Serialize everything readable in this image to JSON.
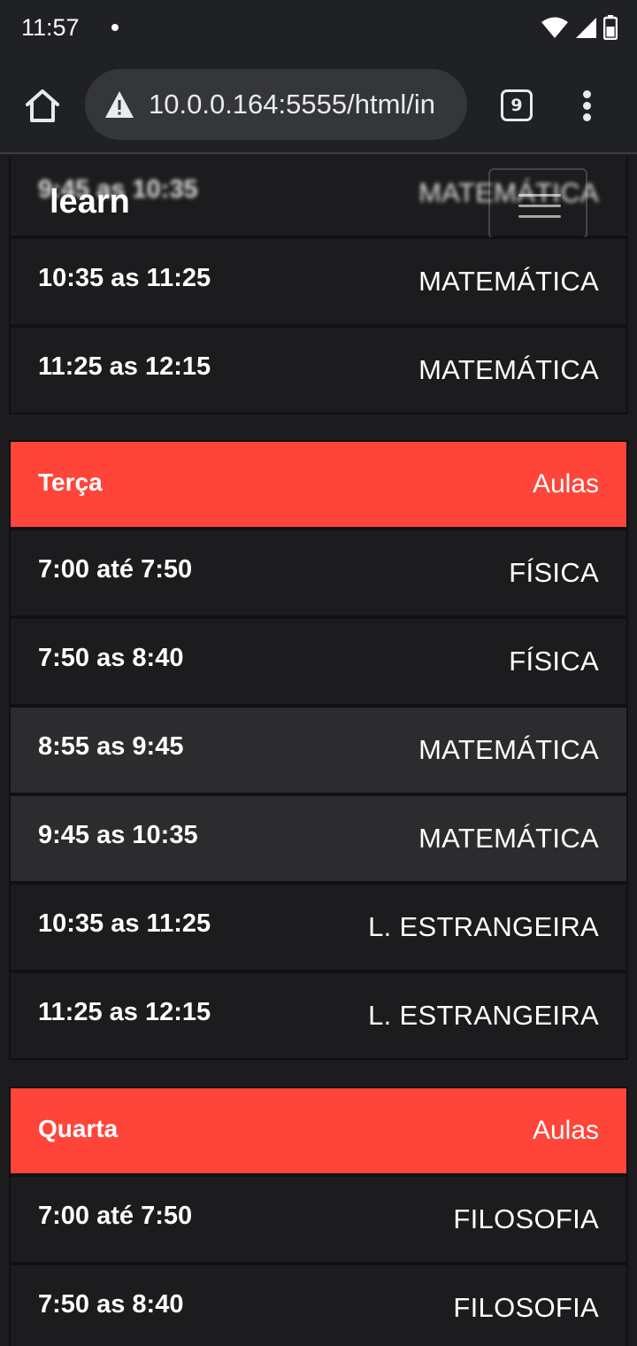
{
  "status_bar": {
    "time": "11:57"
  },
  "browser": {
    "url": "10.0.0.164:5555/html/in",
    "tab_count": "9"
  },
  "navbar": {
    "brand": "learn"
  },
  "partial_row": {
    "time": "9:45 as 10:35",
    "subject": "MATEMÁTICA"
  },
  "segunda_rows": [
    {
      "time": "10:35 as 11:25",
      "subject": "MATEMÁTICA"
    },
    {
      "time": "11:25 as 12:15",
      "subject": "MATEMÁTICA"
    }
  ],
  "terca": {
    "day": "Terça",
    "label": "Aulas",
    "rows": [
      {
        "time": "7:00 até 7:50",
        "subject": "FÍSICA"
      },
      {
        "time": "7:50 as 8:40",
        "subject": "FÍSICA"
      },
      {
        "time": "8:55 as 9:45",
        "subject": "MATEMÁTICA"
      },
      {
        "time": "9:45 as 10:35",
        "subject": "MATEMÁTICA"
      },
      {
        "time": "10:35 as 11:25",
        "subject": "L. ESTRANGEIRA"
      },
      {
        "time": "11:25 as 12:15",
        "subject": "L. ESTRANGEIRA"
      }
    ]
  },
  "quarta": {
    "day": "Quarta",
    "label": "Aulas",
    "rows": [
      {
        "time": "7:00 até 7:50",
        "subject": "FILOSOFIA"
      },
      {
        "time": "7:50 as 8:40",
        "subject": "FILOSOFIA"
      }
    ]
  },
  "colors": {
    "header_red": "#ff453a",
    "row_bg": "#1c1c1e",
    "row_alt_bg": "#2c2c2e"
  },
  "icons": [
    "wifi-icon",
    "signal-icon",
    "battery-icon",
    "home-icon",
    "warning-icon",
    "tabs-icon",
    "more-vert-icon",
    "hamburger-icon"
  ]
}
